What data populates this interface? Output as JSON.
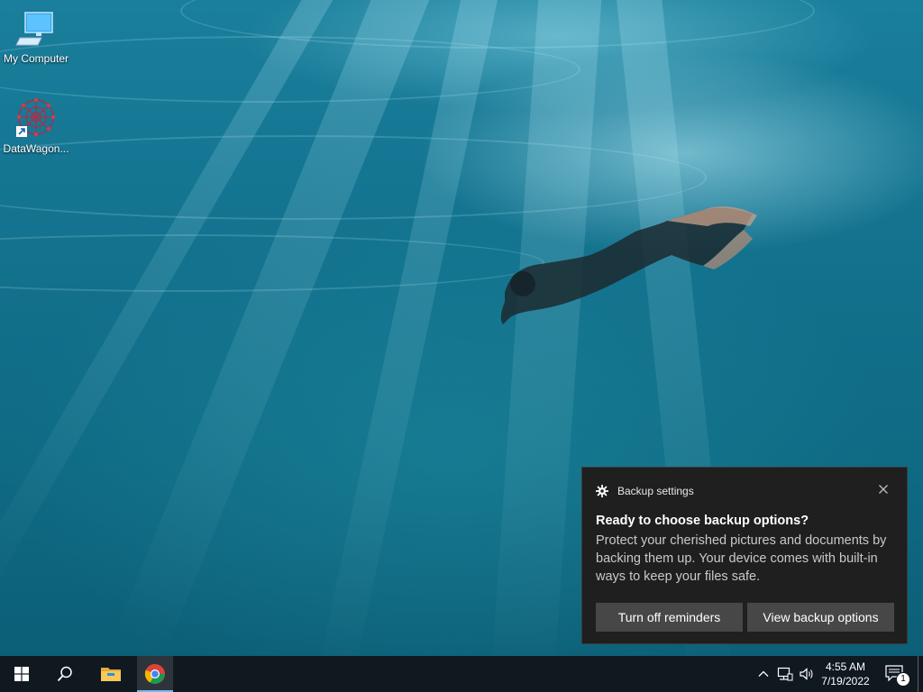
{
  "desktop": {
    "icons": [
      {
        "label": "My Computer",
        "icon": "computer-icon"
      },
      {
        "label": "DataWagon...",
        "icon": "datawagon-shortcut-icon"
      }
    ]
  },
  "toast": {
    "app_name": "Backup settings",
    "title": "Ready to choose backup options?",
    "body": "Protect your cherished pictures and documents by backing them up. Your device comes with built-in ways to keep your files safe.",
    "buttons": {
      "turn_off": "Turn off reminders",
      "view": "View backup options"
    }
  },
  "taskbar": {
    "time": "4:55 AM",
    "date": "7/19/2022",
    "notification_count": "1",
    "pinned": [
      "start-icon",
      "search-icon",
      "file-explorer-icon",
      "chrome-icon"
    ]
  },
  "colors": {
    "toast_bg": "#1f1f1f",
    "button_bg": "#474747",
    "taskbar_bg": "#101820"
  }
}
